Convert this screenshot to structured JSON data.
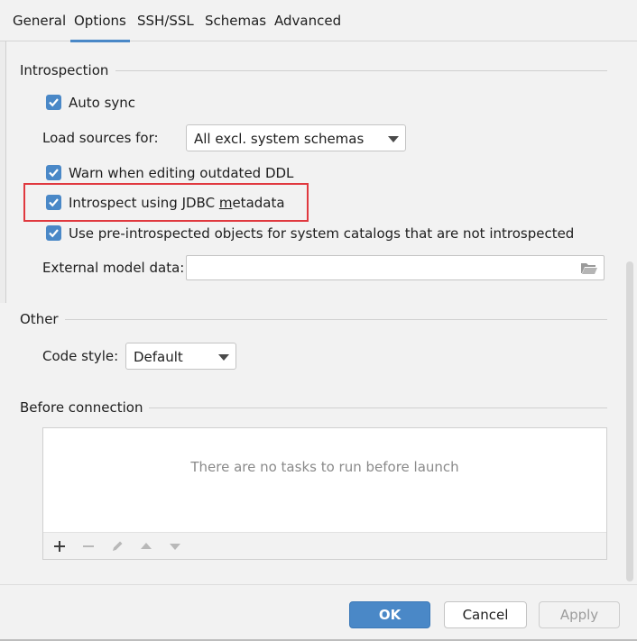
{
  "tabs": [
    {
      "label": "General",
      "active": false
    },
    {
      "label": "Options",
      "active": true
    },
    {
      "label": "SSH/SSL",
      "active": false
    },
    {
      "label": "Schemas",
      "active": false
    },
    {
      "label": "Advanced",
      "active": false
    }
  ],
  "introspection": {
    "title": "Introspection",
    "auto_sync": {
      "label": "Auto sync",
      "checked": true
    },
    "load_sources": {
      "label": "Load sources for:",
      "value": "All excl. system schemas"
    },
    "warn_outdated": {
      "label": "Warn when editing outdated DDL",
      "checked": true
    },
    "introspect_jdbc": {
      "label_prefix": "Introspect using JDBC ",
      "label_mnemonic": "m",
      "label_suffix": "etadata",
      "checked": true
    },
    "pre_introspected": {
      "label": "Use pre-introspected objects for system catalogs that are not introspected",
      "checked": true
    },
    "external_model": {
      "label": "External model data:",
      "value": ""
    }
  },
  "other": {
    "title": "Other",
    "code_style": {
      "label": "Code style:",
      "value": "Default"
    }
  },
  "before_connection": {
    "title": "Before connection",
    "empty_text": "There are no tasks to run before launch",
    "toolbar_icons": [
      "add-icon",
      "remove-icon",
      "edit-icon",
      "move-up-icon",
      "move-down-icon"
    ]
  },
  "footer": {
    "ok_label": "OK",
    "cancel_label": "Cancel",
    "apply_label": "Apply"
  },
  "colors": {
    "accent": "#4a88c7",
    "highlight": "#e0393f",
    "background": "#f2f2f2"
  }
}
